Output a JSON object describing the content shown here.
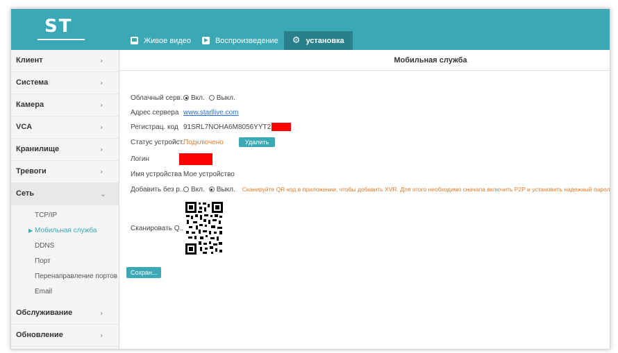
{
  "app": {
    "logo": "ST"
  },
  "topnav": [
    {
      "label": "Живое видео",
      "icon": "monitor-icon"
    },
    {
      "label": "Воспроизведение",
      "icon": "play-icon"
    },
    {
      "label": "установка",
      "icon": "gear-icon"
    }
  ],
  "sidebar": {
    "items": [
      {
        "label": "Клиент",
        "chevron": "›"
      },
      {
        "label": "Система",
        "chevron": "›"
      },
      {
        "label": "Камера",
        "chevron": "›"
      },
      {
        "label": "VCA",
        "chevron": "›"
      },
      {
        "label": "Кранилище",
        "chevron": "›"
      },
      {
        "label": "Тревоги",
        "chevron": "›"
      },
      {
        "label": "Сеть",
        "chevron": "⌄"
      }
    ],
    "subitems": [
      {
        "label": "TCP/IP"
      },
      {
        "label": "Мобильная служба"
      },
      {
        "label": "DDNS"
      },
      {
        "label": "Порт"
      },
      {
        "label": "Перенаправление портов"
      },
      {
        "label": "Email"
      }
    ],
    "bottom_items": [
      {
        "label": "Обслуживание",
        "chevron": "›"
      },
      {
        "label": "Обновление",
        "chevron": "›"
      }
    ]
  },
  "main": {
    "title": "Мобильная служба",
    "cloud": {
      "label": "Облачный серв...",
      "on": "Вкл.",
      "off": "Выкл.",
      "selected": "on"
    },
    "server": {
      "label": "Адрес сервера",
      "value": "www.starllive.com"
    },
    "regcode": {
      "label": "Регистрац. код",
      "value": "91SRL7NOHA6M8056YYT2"
    },
    "device_status": {
      "label": "Статус устройст...",
      "value": "Подключено",
      "button": "Удалить"
    },
    "login": {
      "label": "Логин"
    },
    "device_name": {
      "label": "Имя устройства",
      "value": "Мое устройство"
    },
    "add_without": {
      "label": "Добавить без р...",
      "on": "Вкл.",
      "off": "Выкл.",
      "selected": "off",
      "hint": "Сканируйте QR-код в приложении, чтобы добавить XVR. Для этого необходимо сначала включить P2P и установить надежный пароль."
    },
    "scan": {
      "label": "Сканировать Q..."
    },
    "save_button": "Сохран..."
  },
  "colors": {
    "accent": "#3ba8b6",
    "accent_dark": "#2a7f8d",
    "status": "#e07b2a",
    "redaction": "#ff0000",
    "link": "#2a6fd6"
  }
}
